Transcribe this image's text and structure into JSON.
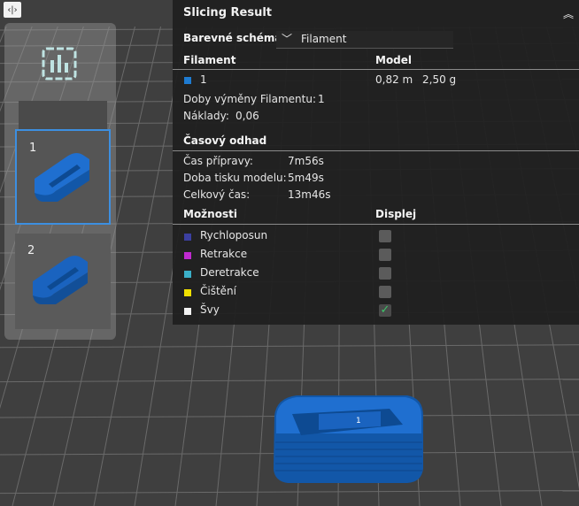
{
  "corner_button": {
    "label": "‹|›"
  },
  "plates": [
    {
      "number": "1",
      "selected": true
    },
    {
      "number": "2",
      "selected": false
    }
  ],
  "result_panel": {
    "title": "Slicing Result",
    "color_scheme_label": "Barevné schéma",
    "color_scheme_value": "Filament",
    "filament_header": "Filament",
    "model_header": "Model",
    "filament_row": {
      "id": "1",
      "length": "0,82 m",
      "weight": "2,50 g",
      "color": "#1e7bd1"
    },
    "changes_label": "Doby výměny Filamentu:",
    "changes_value": "1",
    "cost_label": "Náklady:",
    "cost_value": "0,06",
    "time_header": "Časový odhad",
    "prep_label": "Čas přípravy:",
    "prep_value": "7m56s",
    "print_label": "Doba tisku modelu:",
    "print_value": "5m49s",
    "total_label": "Celkový čas:",
    "total_value": "13m46s",
    "options_header": "Možnosti",
    "display_header": "Displej",
    "options": [
      {
        "label": "Rychloposun",
        "color": "#3b3fa0",
        "checked": false
      },
      {
        "label": "Retrakce",
        "color": "#c02ad0",
        "checked": false
      },
      {
        "label": "Deretrakce",
        "color": "#3bb0c9",
        "checked": false
      },
      {
        "label": "Čištění",
        "color": "#f0e000",
        "checked": false
      },
      {
        "label": "Švy",
        "color": "#f2f2f2",
        "checked": true
      }
    ]
  },
  "model_label": "1",
  "colors": {
    "model_blue": "#1e6fd0",
    "grid": "#6c6c6c",
    "bed": "#3f3f3f"
  }
}
